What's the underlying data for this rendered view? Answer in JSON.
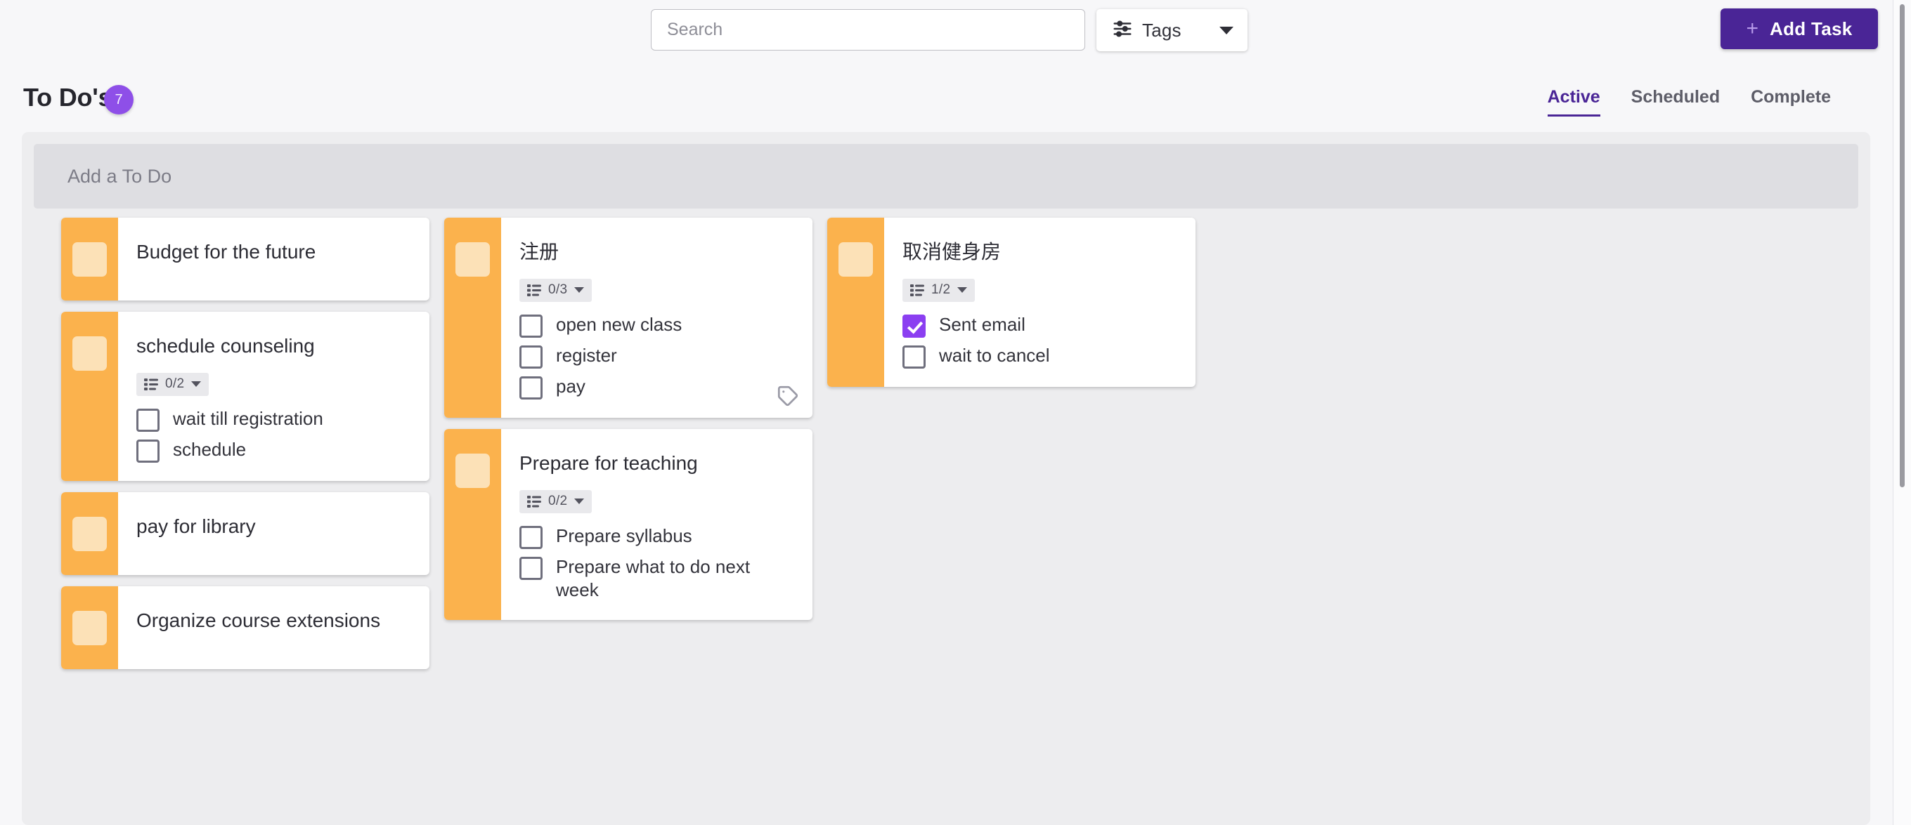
{
  "topbar": {
    "search": {
      "placeholder": "Search",
      "value": ""
    },
    "tags_button": {
      "label": "Tags",
      "icon": "sliders-icon",
      "caret": "chevron-down-icon"
    },
    "add_task_button": {
      "label": "Add Task",
      "plus": "+",
      "color": "#4A2596"
    }
  },
  "header": {
    "title": "To Do's",
    "count": "7",
    "badge_color": "#8E4FE8",
    "tabs": [
      {
        "label": "Active",
        "active": true
      },
      {
        "label": "Scheduled",
        "active": false
      },
      {
        "label": "Complete",
        "active": false
      }
    ]
  },
  "board": {
    "add_todo_placeholder": "Add a To Do",
    "stripe_color": "#FBB24D",
    "checked_color": "#8B3FF1",
    "columns": [
      {
        "cards": [
          {
            "title": "Budget for the future",
            "has_subtasks": false,
            "subtasks": [],
            "progress": "",
            "has_tag_icon": false
          },
          {
            "title": "schedule counseling",
            "has_subtasks": true,
            "progress": "0/2",
            "subtasks": [
              {
                "label": "wait till registration",
                "checked": false
              },
              {
                "label": "schedule",
                "checked": false
              }
            ],
            "has_tag_icon": false
          },
          {
            "title": "pay for library",
            "has_subtasks": false,
            "progress": "",
            "subtasks": [],
            "has_tag_icon": false
          },
          {
            "title": "Organize course extensions",
            "has_subtasks": false,
            "progress": "",
            "subtasks": [],
            "has_tag_icon": false
          }
        ]
      },
      {
        "cards": [
          {
            "title": "注册",
            "has_subtasks": true,
            "progress": "0/3",
            "subtasks": [
              {
                "label": "open new class",
                "checked": false
              },
              {
                "label": "register",
                "checked": false
              },
              {
                "label": "pay",
                "checked": false
              }
            ],
            "has_tag_icon": true
          },
          {
            "title": "Prepare for teaching",
            "has_subtasks": true,
            "progress": "0/2",
            "subtasks": [
              {
                "label": "Prepare syllabus",
                "checked": false
              },
              {
                "label": "Prepare what to do next week",
                "checked": false
              }
            ],
            "has_tag_icon": false
          }
        ]
      },
      {
        "cards": [
          {
            "title": "取消健身房",
            "has_subtasks": true,
            "progress": "1/2",
            "subtasks": [
              {
                "label": "Sent email",
                "checked": true
              },
              {
                "label": "wait to cancel",
                "checked": false
              }
            ],
            "has_tag_icon": false
          }
        ]
      }
    ]
  }
}
